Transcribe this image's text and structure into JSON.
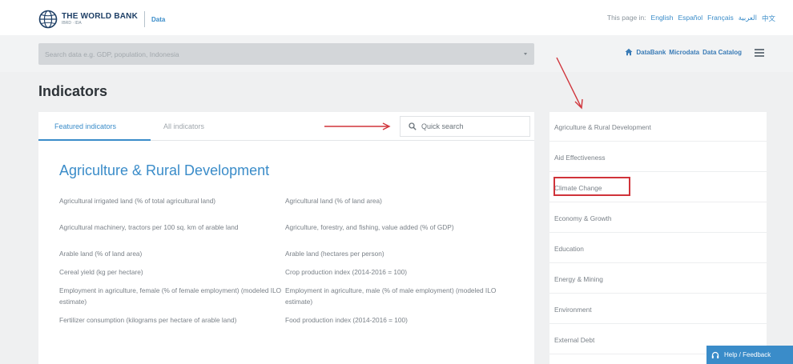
{
  "header": {
    "logo_name": "THE WORLD BANK",
    "logo_sub": "IBRD · IDA",
    "logo_section": "Data",
    "lang_prefix": "This page in:",
    "languages": [
      "English",
      "Español",
      "Français",
      "العربية",
      "中文"
    ]
  },
  "search": {
    "placeholder": "Search data e.g. GDP, population, Indonesia"
  },
  "toplinks": {
    "databank": "DataBank",
    "microdata": "Microdata",
    "catalog": "Data Catalog"
  },
  "page_title": "Indicators",
  "tabs": {
    "featured": "Featured indicators",
    "all": "All indicators",
    "quick_search": "Quick search"
  },
  "section_title": "Agriculture & Rural Development",
  "indicators": [
    [
      "Agricultural irrigated land (% of total agricultural land)",
      "Agricultural land (% of land area)"
    ],
    [
      "Agricultural machinery, tractors per 100 sq. km of arable land",
      "Agriculture, forestry, and fishing, value added (% of GDP)"
    ],
    [
      "Arable land (% of land area)",
      "Arable land (hectares per person)"
    ],
    [
      "Cereal yield (kg per hectare)",
      "Crop production index (2014-2016 = 100)"
    ],
    [
      "Employment in agriculture, female (% of female employment) (modeled ILO estimate)",
      "Employment in agriculture, male (% of male employment) (modeled ILO estimate)"
    ],
    [
      "Fertilizer consumption (kilograms per hectare of arable land)",
      "Food production index (2014-2016 = 100)"
    ]
  ],
  "topics": [
    "Agriculture & Rural Development",
    "Aid Effectiveness",
    "Climate Change",
    "Economy & Growth",
    "Education",
    "Energy & Mining",
    "Environment",
    "External Debt"
  ],
  "help": "Help / Feedback",
  "colors": {
    "accent": "#3a8cc9",
    "highlight": "#d0333a"
  }
}
